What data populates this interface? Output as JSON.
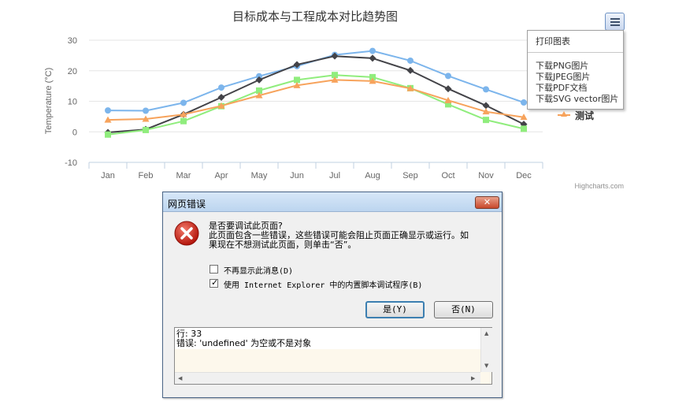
{
  "chart": {
    "title": "目标成本与工程成本对比趋势图",
    "credit": "Highcharts.com",
    "menu": {
      "items": [
        "打印图表",
        "下载PNG图片",
        "下载JPEG图片",
        "下载PDF文档",
        "下载SVG vector图片"
      ],
      "button_icon": "hamburger-menu-icon"
    },
    "legend_visible_label": "测试"
  },
  "chart_data": {
    "type": "line",
    "title": "目标成本与工程成本对比趋势图",
    "categories": [
      "Jan",
      "Feb",
      "Mar",
      "Apr",
      "May",
      "Jun",
      "Jul",
      "Aug",
      "Sep",
      "Oct",
      "Nov",
      "Dec"
    ],
    "ylabel": "Temperature (°C)",
    "ylim": [
      -10,
      30
    ],
    "yticks": [
      -10,
      0,
      10,
      20,
      30
    ],
    "grid": true,
    "legend_position": "right",
    "series": [
      {
        "values": [
          7.0,
          6.9,
          9.5,
          14.5,
          18.2,
          21.5,
          25.2,
          26.5,
          23.3,
          18.3,
          13.9,
          9.6
        ],
        "color": "#7cb5ec",
        "marker": "circle"
      },
      {
        "values": [
          -0.2,
          0.8,
          5.7,
          11.3,
          17.0,
          22.0,
          24.8,
          24.1,
          20.1,
          14.1,
          8.6,
          2.5
        ],
        "color": "#434348",
        "marker": "diamond"
      },
      {
        "values": [
          -0.9,
          0.6,
          3.5,
          8.4,
          13.5,
          17.0,
          18.6,
          17.9,
          14.3,
          9.0,
          3.9,
          1.0
        ],
        "color": "#90ed7d",
        "marker": "square"
      },
      {
        "name": "测试",
        "values": [
          3.9,
          4.2,
          5.7,
          8.5,
          11.9,
          15.2,
          17.0,
          16.6,
          14.2,
          10.3,
          6.6,
          4.8
        ],
        "color": "#f7a35c",
        "marker": "triangle"
      }
    ]
  },
  "dialog": {
    "title": "网页错误",
    "close_icon": "close-icon",
    "error_icon": "error-icon",
    "question": "是否要调试此页面?",
    "message_line1": "此页面包含一些错误，这些错误可能会阻止页面正确显示或运行。如",
    "message_line2": "果现在不想测试此页面，则单击“否”。",
    "checkbox_dont_show": {
      "label": "不再显示此消息(D)",
      "checked": false
    },
    "checkbox_use_debugger": {
      "label": "使用 Internet Explorer 中的内置脚本调试程序(B)",
      "checked": true
    },
    "yes_label": "是(Y)",
    "no_label": "否(N)",
    "detail_line1": "行: 33",
    "detail_line2": "错误: 'undefined' 为空或不是对象"
  }
}
